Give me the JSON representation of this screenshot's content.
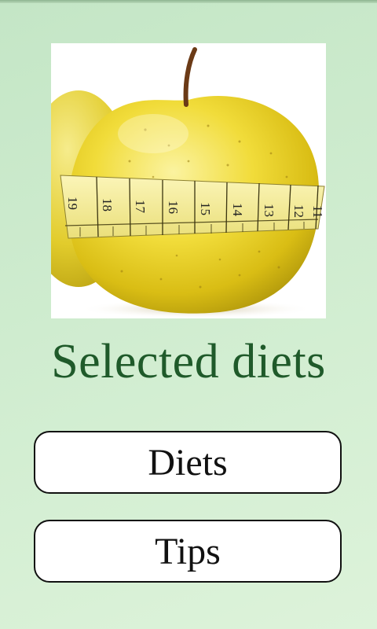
{
  "app": {
    "title": "Selected diets"
  },
  "hero_image": {
    "icon": "apple-with-measuring-tape",
    "tape_numbers": [
      "19",
      "18",
      "17",
      "16",
      "15",
      "14",
      "13",
      "12",
      "11"
    ]
  },
  "menu": {
    "diets_label": "Diets",
    "tips_label": "Tips"
  },
  "colors": {
    "background": "#cfeccf",
    "title_text": "#1f5a2a",
    "button_background": "#ffffff",
    "button_border": "#111111"
  }
}
